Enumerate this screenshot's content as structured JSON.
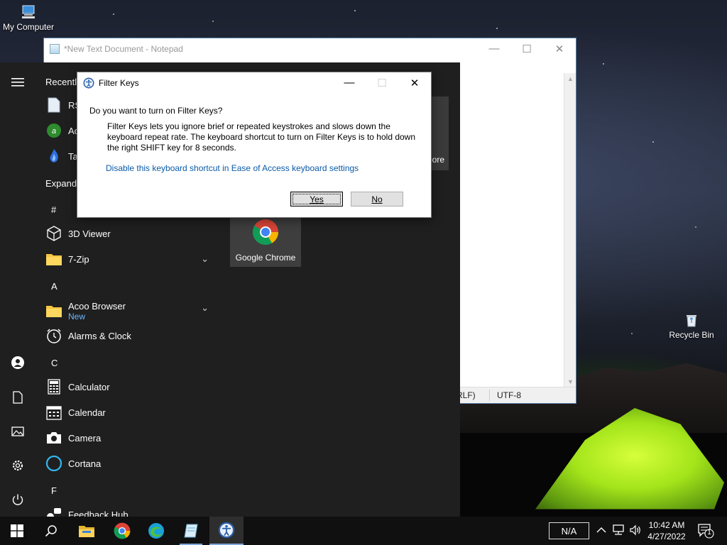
{
  "desktop": {
    "my_computer_label": "My Computer",
    "recycle_bin_label": "Recycle Bin"
  },
  "notepad": {
    "title": "*New Text Document - Notepad",
    "status_line_ending_fragment": "RLF)",
    "status_encoding": "UTF-8"
  },
  "start_menu": {
    "recently_header": "Recently",
    "recent_items": [
      {
        "label": "RS",
        "icon": "document-icon"
      },
      {
        "label": "Ac",
        "icon": "acrobat-icon"
      },
      {
        "label": "Ta",
        "icon": "flame-icon"
      }
    ],
    "expand_label": "Expand",
    "headers": {
      "hash": "#",
      "a": "A",
      "c": "C",
      "f": "F"
    },
    "apps": {
      "viewer3d": "3D Viewer",
      "zip": "7-Zip",
      "acoo": "Acoo Browser",
      "acoo_badge": "New",
      "alarms": "Alarms & Clock",
      "calculator": "Calculator",
      "calendar": "Calendar",
      "camera": "Camera",
      "cortana": "Cortana",
      "feedback": "Feedback Hub"
    },
    "tiles": {
      "chrome_label": "Google Chrome",
      "partial_label": "ore"
    }
  },
  "dialog": {
    "title": "Filter Keys",
    "question": "Do you want to turn on Filter Keys?",
    "description": "Filter Keys lets you ignore brief or repeated keystrokes and slows down the keyboard repeat rate.  The keyboard shortcut to turn on Filter Keys is to hold down the right SHIFT key for 8 seconds.",
    "link": "Disable this keyboard shortcut in Ease of Access keyboard settings",
    "yes_label": "Yes",
    "no_label": "No"
  },
  "taskbar": {
    "input_indicator": "N/A",
    "time": "10:42 AM",
    "date": "4/27/2022",
    "notification_count": "1"
  },
  "colors": {
    "link": "#0b5aa8",
    "accent": "#7ea7d8",
    "start_bg": "#1f1f1f"
  }
}
